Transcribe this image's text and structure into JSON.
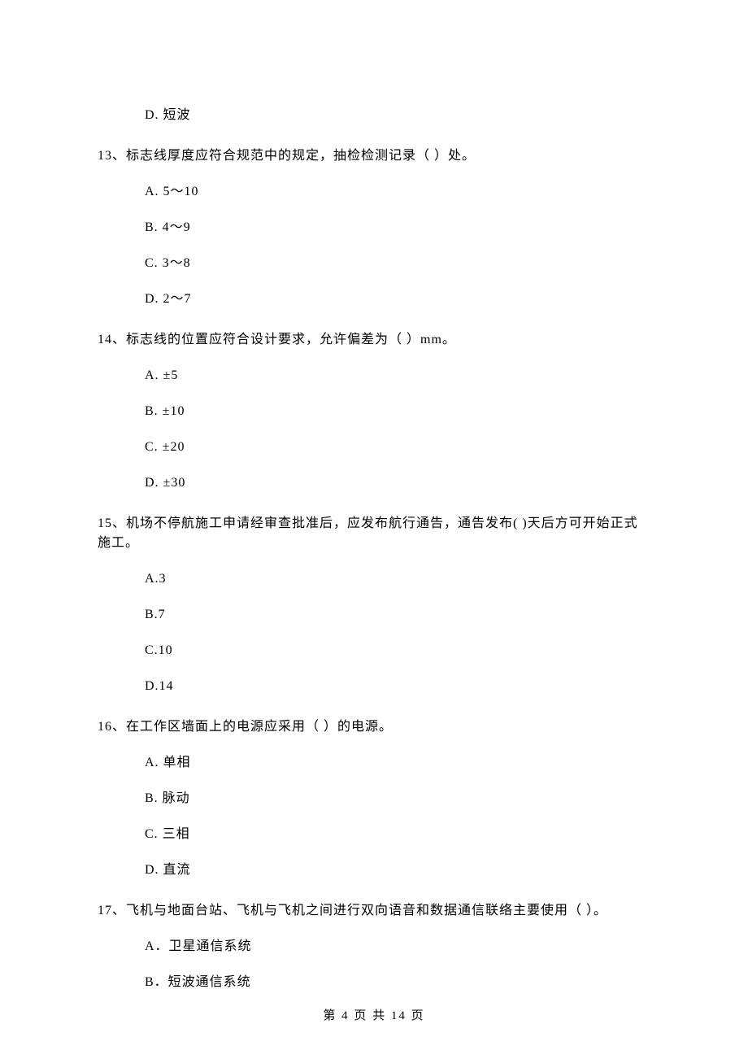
{
  "q12": {
    "opt_d": "D.  短波"
  },
  "q13": {
    "text": "13、标志线厚度应符合规范中的规定，抽检检测记录（    ）处。",
    "opt_a": "A.  5～10",
    "opt_b": "B.  4～9",
    "opt_c": "C.  3～8",
    "opt_d": "D.  2～7"
  },
  "q14": {
    "text": "14、标志线的位置应符合设计要求，允许偏差为（    ）mm。",
    "opt_a": "A.  ±5",
    "opt_b": "B.  ±10",
    "opt_c": "C.  ±20",
    "opt_d": "D.  ±30"
  },
  "q15": {
    "text": "15、机场不停航施工申请经审查批准后，应发布航行通告，通告发布(    )天后方可开始正式施工。",
    "opt_a": "A.3",
    "opt_b": "B.7",
    "opt_c": "C.10",
    "opt_d": "D.14"
  },
  "q16": {
    "text": "16、在工作区墙面上的电源应采用（    ）的电源。",
    "opt_a": "A.  单相",
    "opt_b": "B.  脉动",
    "opt_c": "C.  三相",
    "opt_d": "D.  直流"
  },
  "q17": {
    "text": "17、飞机与地面台站、飞机与飞机之间进行双向语音和数据通信联络主要使用（    ）。",
    "opt_a": "A．卫星通信系统",
    "opt_b": "B．短波通信系统"
  },
  "footer": "第 4 页 共 14 页"
}
